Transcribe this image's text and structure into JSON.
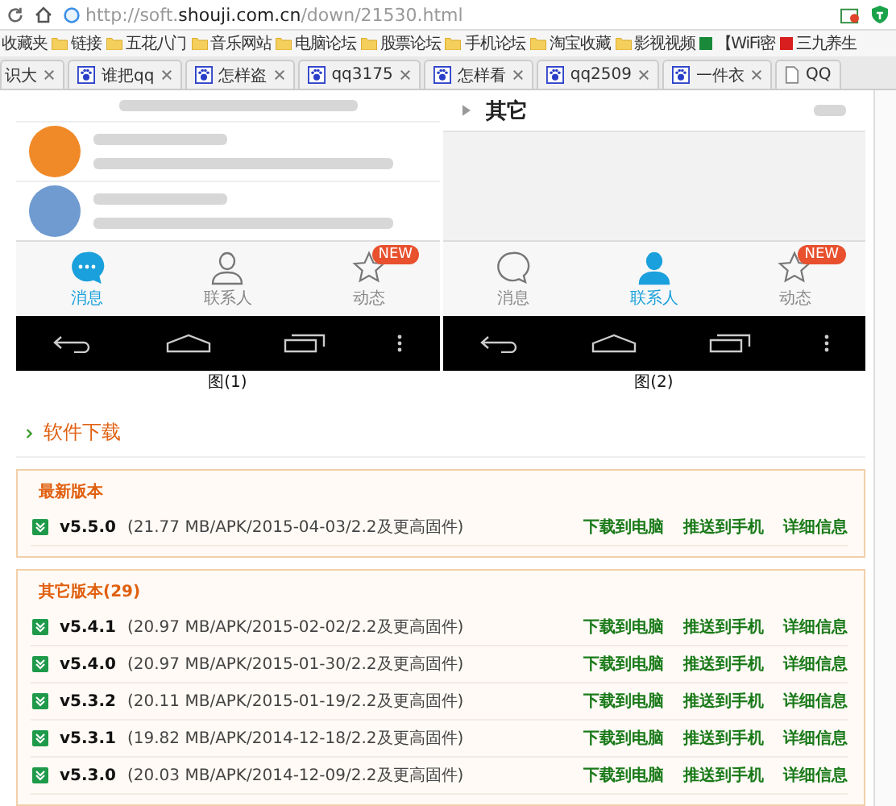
{
  "address_bar": {
    "url_scheme": "http://soft.",
    "url_domain": "shouji.com.cn",
    "url_path": "/down/21530.html"
  },
  "bookmarks": [
    {
      "label": "收藏夹",
      "kind": "text"
    },
    {
      "label": "链接",
      "kind": "folder"
    },
    {
      "label": "五花八门",
      "kind": "folder"
    },
    {
      "label": "音乐网站",
      "kind": "folder"
    },
    {
      "label": "电脑论坛",
      "kind": "folder"
    },
    {
      "label": "股票论坛",
      "kind": "folder"
    },
    {
      "label": "手机论坛",
      "kind": "folder"
    },
    {
      "label": "淘宝收藏",
      "kind": "folder"
    },
    {
      "label": "影视视频",
      "kind": "folder"
    },
    {
      "label": "【WiFi密",
      "kind": "site",
      "color": "#1a8a3a"
    },
    {
      "label": "三九养生",
      "kind": "site",
      "color": "#d81e1e"
    }
  ],
  "tabs": [
    {
      "label": "识大",
      "kind": "plain",
      "selected": false
    },
    {
      "label": "谁把qq",
      "kind": "paw",
      "selected": false
    },
    {
      "label": "怎样盗",
      "kind": "paw",
      "selected": false
    },
    {
      "label": "qq3175",
      "kind": "paw",
      "selected": false
    },
    {
      "label": "怎样看",
      "kind": "paw",
      "selected": false
    },
    {
      "label": "qq2509",
      "kind": "paw",
      "selected": false
    },
    {
      "label": "一件衣",
      "kind": "paw",
      "selected": false
    },
    {
      "label": "QQ",
      "kind": "page",
      "selected": false
    }
  ],
  "screenshots": [
    {
      "kind": "chats",
      "caption": "图(1)",
      "nav": [
        {
          "label": "消息",
          "selected": true
        },
        {
          "label": "联系人",
          "selected": false
        },
        {
          "label": "动态",
          "selected": false,
          "badge": "NEW"
        }
      ]
    },
    {
      "kind": "contacts",
      "group_label": "其它",
      "caption": "图(2)",
      "nav": [
        {
          "label": "消息",
          "selected": false
        },
        {
          "label": "联系人",
          "selected": true
        },
        {
          "label": "动态",
          "selected": false,
          "badge": "NEW"
        }
      ]
    }
  ],
  "download": {
    "title": "软件下载",
    "sections": [
      {
        "heading": "最新版本",
        "rows": [
          {
            "version": "v5.5.0",
            "info": "(21.77 MB/APK/2015-04-03/2.2及更高固件)",
            "actions": [
              "下载到电脑",
              "推送到手机",
              "详细信息"
            ]
          }
        ]
      },
      {
        "heading": "其它版本(29)",
        "rows": [
          {
            "version": "v5.4.1",
            "info": "(20.97 MB/APK/2015-02-02/2.2及更高固件)",
            "actions": [
              "下载到电脑",
              "推送到手机",
              "详细信息"
            ]
          },
          {
            "version": "v5.4.0",
            "info": "(20.97 MB/APK/2015-01-30/2.2及更高固件)",
            "actions": [
              "下载到电脑",
              "推送到手机",
              "详细信息"
            ]
          },
          {
            "version": "v5.3.2",
            "info": "(20.11 MB/APK/2015-01-19/2.2及更高固件)",
            "actions": [
              "下载到电脑",
              "推送到手机",
              "详细信息"
            ]
          },
          {
            "version": "v5.3.1",
            "info": "(19.82 MB/APK/2014-12-18/2.2及更高固件)",
            "actions": [
              "下载到电脑",
              "推送到手机",
              "详细信息"
            ]
          },
          {
            "version": "v5.3.0",
            "info": "(20.03 MB/APK/2014-12-09/2.2及更高固件)",
            "actions": [
              "下载到电脑",
              "推送到手机",
              "详细信息"
            ]
          }
        ]
      }
    ]
  }
}
